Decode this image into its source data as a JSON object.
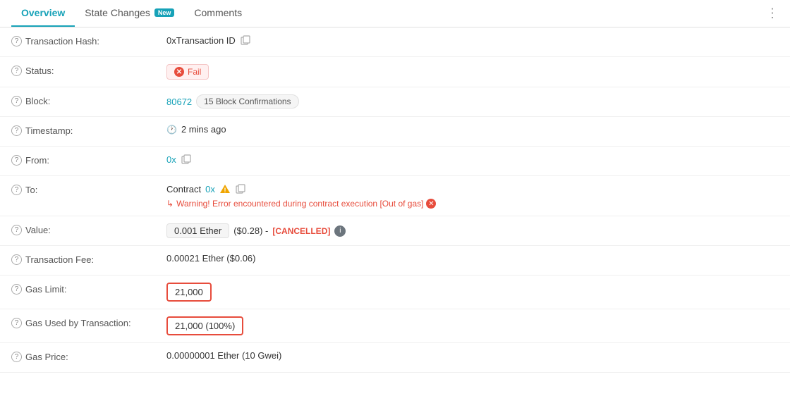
{
  "tabs": [
    {
      "id": "overview",
      "label": "Overview",
      "active": true,
      "badge": null
    },
    {
      "id": "state-changes",
      "label": "State Changes",
      "active": false,
      "badge": "New"
    },
    {
      "id": "comments",
      "label": "Comments",
      "active": false,
      "badge": null
    }
  ],
  "rows": [
    {
      "id": "transaction-hash",
      "label": "Transaction Hash:",
      "value": "0xTransaction ID",
      "type": "hash"
    },
    {
      "id": "status",
      "label": "Status:",
      "value": "Fail",
      "type": "status"
    },
    {
      "id": "block",
      "label": "Block:",
      "blockNumber": "80672",
      "confirmations": "15 Block Confirmations",
      "type": "block"
    },
    {
      "id": "timestamp",
      "label": "Timestamp:",
      "value": "2 mins ago",
      "type": "timestamp"
    },
    {
      "id": "from",
      "label": "From:",
      "value": "0x",
      "type": "from"
    },
    {
      "id": "to",
      "label": "To:",
      "contractLabel": "Contract",
      "contractAddress": "0x",
      "warningText": "Warning! Error encountered during contract execution [Out of gas]",
      "type": "to"
    },
    {
      "id": "value",
      "label": "Value:",
      "ethValue": "0.001 Ether",
      "usdValue": "($0.28) -",
      "cancelled": "[CANCELLED]",
      "type": "value"
    },
    {
      "id": "transaction-fee",
      "label": "Transaction Fee:",
      "value": "0.00021 Ether ($0.06)",
      "type": "plain"
    },
    {
      "id": "gas-limit",
      "label": "Gas Limit:",
      "value": "21,000",
      "type": "gas-highlight"
    },
    {
      "id": "gas-used",
      "label": "Gas Used by Transaction:",
      "value": "21,000 (100%)",
      "type": "gas-highlight"
    },
    {
      "id": "gas-price",
      "label": "Gas Price:",
      "value": "0.00000001 Ether (10 Gwei)",
      "type": "plain"
    }
  ]
}
